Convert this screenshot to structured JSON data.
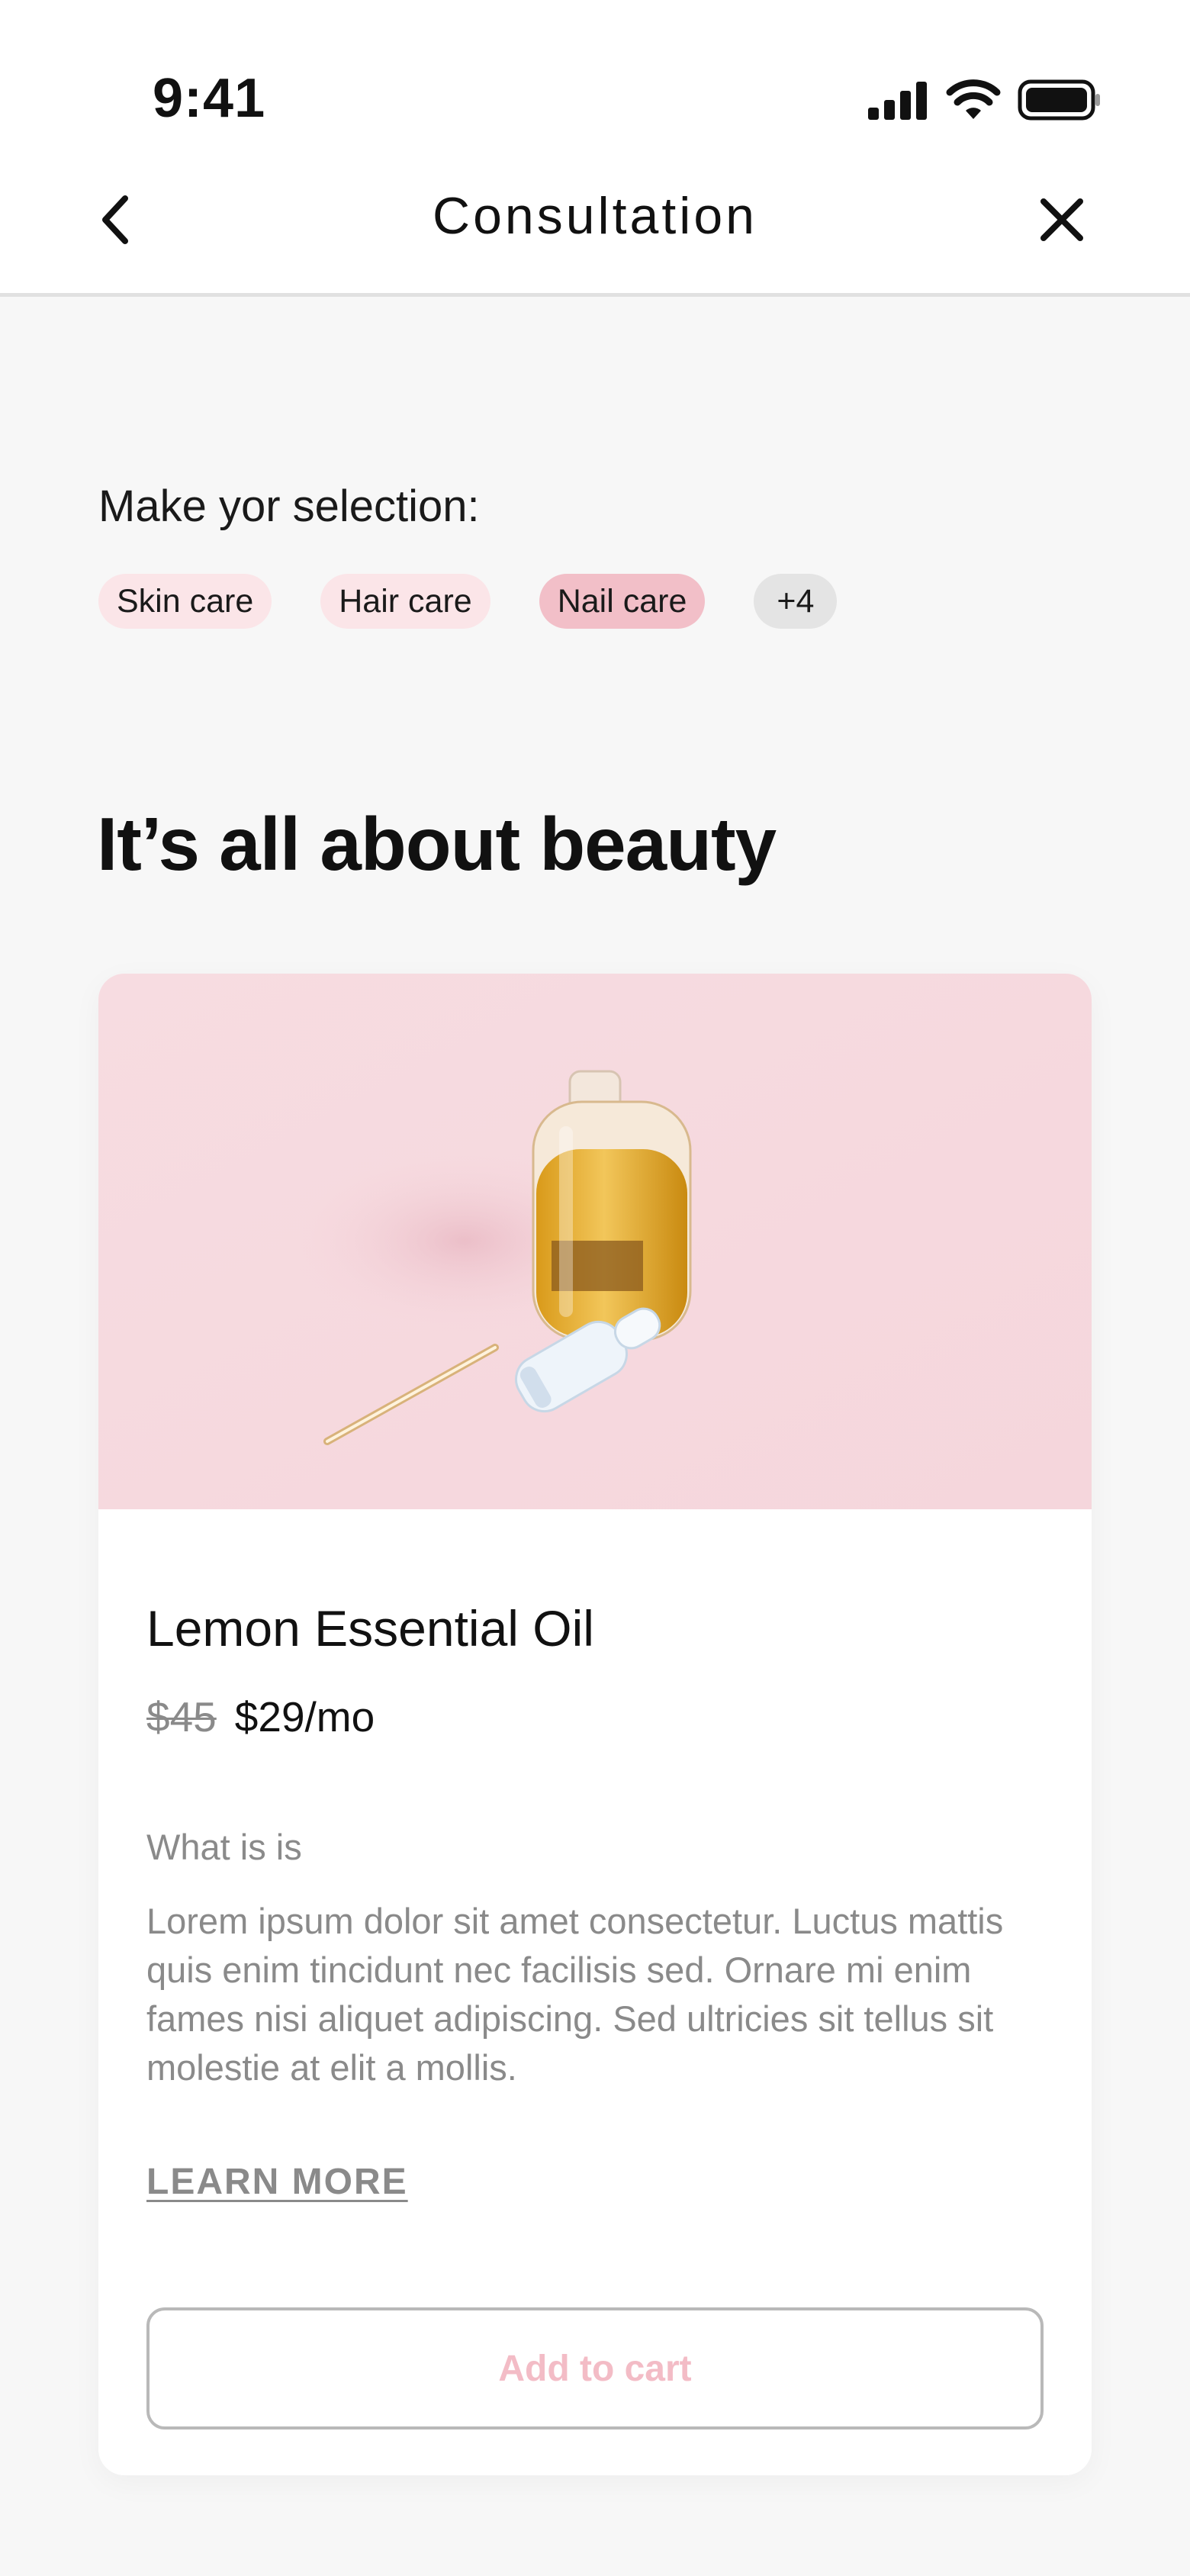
{
  "status_bar": {
    "time": "9:41"
  },
  "nav": {
    "title": "Consultation"
  },
  "selection": {
    "prompt": "Make yor selection:",
    "chips": [
      {
        "label": "Skin care"
      },
      {
        "label": "Hair care"
      },
      {
        "label": "Nail care",
        "selected": true
      },
      {
        "label": "+4"
      }
    ]
  },
  "headline": "It’s all about beauty",
  "product": {
    "title": "Lemon Essential Oil",
    "price_old": "$45",
    "price_new": "$29/mo",
    "section_label": "What is is",
    "description": "Lorem ipsum dolor sit amet consectetur. Luctus mattis quis enim tincidunt nec facilisis sed. Ornare mi enim fames nisi aliquet adipiscing. Sed ultricies sit tellus sit molestie at elit a mollis.",
    "learn_more": "LEARN MORE",
    "add_to_cart": "Add to cart"
  },
  "colors": {
    "background": "#f7f7f7",
    "chip_pink": "#fbe5e8",
    "chip_selected": "#f2bfc8",
    "chip_more": "#e4e4e4",
    "accent_text": "#f3bcc6",
    "muted_text": "#8a8a8a"
  }
}
